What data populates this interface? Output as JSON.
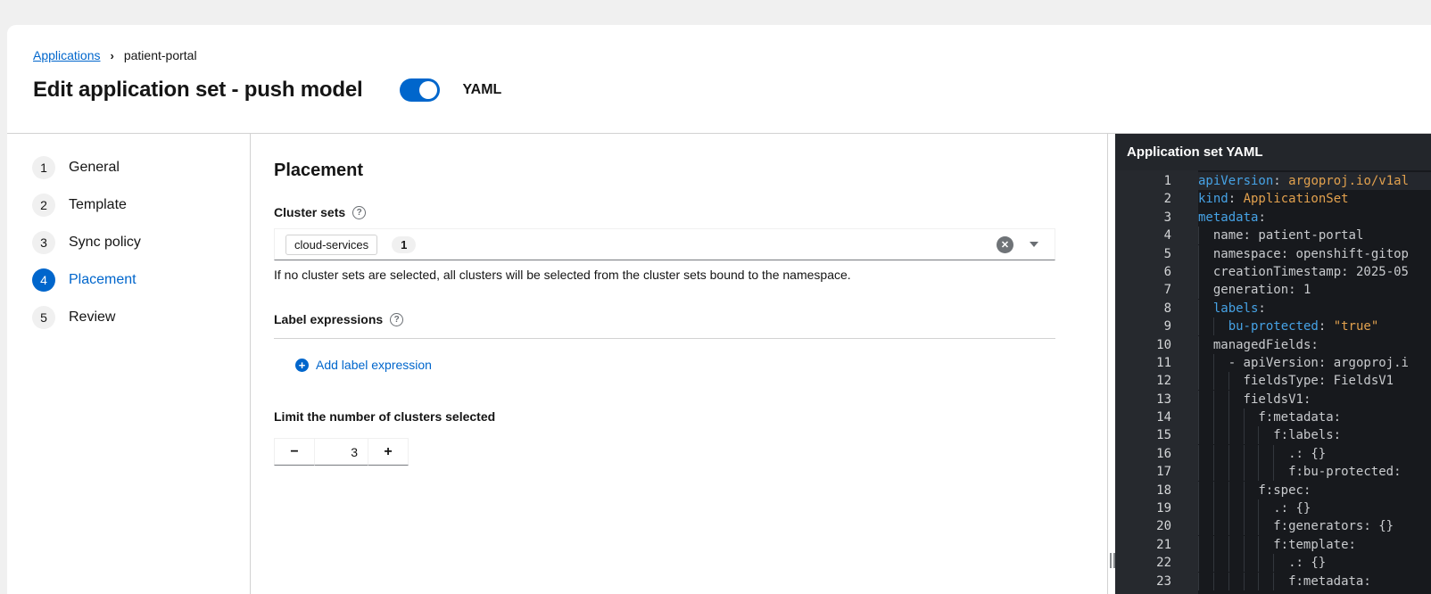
{
  "breadcrumb": {
    "link": "Applications",
    "current": "patient-portal"
  },
  "header": {
    "title": "Edit application set - push model",
    "toggle_label": "YAML",
    "toggle_on": true
  },
  "wizard": {
    "steps": [
      {
        "num": "1",
        "label": "General",
        "active": false
      },
      {
        "num": "2",
        "label": "Template",
        "active": false
      },
      {
        "num": "3",
        "label": "Sync policy",
        "active": false
      },
      {
        "num": "4",
        "label": "Placement",
        "active": true
      },
      {
        "num": "5",
        "label": "Review",
        "active": false
      }
    ]
  },
  "content": {
    "heading": "Placement",
    "cluster_sets": {
      "label": "Cluster sets",
      "chip": "cloud-services",
      "badge": "1",
      "helper": "If no cluster sets are selected, all clusters will be selected from the cluster sets bound to the namespace."
    },
    "label_expressions": {
      "label": "Label expressions",
      "add_link": "Add label expression"
    },
    "limit": {
      "label": "Limit the number of clusters selected",
      "value": "3"
    }
  },
  "icons": {
    "breadcrumb_separator": "›",
    "help": "?",
    "clear": "✕",
    "plus": "+",
    "minus": "−",
    "stepper_plus": "+"
  },
  "colors": {
    "accent_blue": "#0066cc",
    "page_bg": "#f0f0f0",
    "border": "#d2d2d2",
    "editor_bg": "#17191d",
    "editor_gutter_bg": "#26292e",
    "panel_header_bg": "#23262b",
    "yaml_key": "#46a2e5",
    "yaml_value": "#e2a14e",
    "yaml_plain": "#c9cbce"
  },
  "yaml_panel": {
    "title": "Application set YAML",
    "lines": [
      {
        "num": "1",
        "indent": 0,
        "hl": true,
        "parts": [
          [
            "k",
            "apiVersion"
          ],
          [
            "p",
            ": "
          ],
          [
            "v",
            "argoproj.io/v1al"
          ]
        ]
      },
      {
        "num": "2",
        "indent": 0,
        "hl": false,
        "parts": [
          [
            "k",
            "kind"
          ],
          [
            "p",
            ": "
          ],
          [
            "v",
            "ApplicationSet"
          ]
        ]
      },
      {
        "num": "3",
        "indent": 0,
        "hl": false,
        "parts": [
          [
            "k",
            "metadata"
          ],
          [
            "p",
            ":"
          ]
        ]
      },
      {
        "num": "4",
        "indent": 2,
        "hl": false,
        "parts": [
          [
            "p",
            "name: patient-portal"
          ]
        ]
      },
      {
        "num": "5",
        "indent": 2,
        "hl": false,
        "parts": [
          [
            "p",
            "namespace: openshift-gitop"
          ]
        ]
      },
      {
        "num": "6",
        "indent": 2,
        "hl": false,
        "parts": [
          [
            "p",
            "creationTimestamp: 2025-05"
          ]
        ]
      },
      {
        "num": "7",
        "indent": 2,
        "hl": false,
        "parts": [
          [
            "p",
            "generation: 1"
          ]
        ]
      },
      {
        "num": "8",
        "indent": 2,
        "hl": false,
        "parts": [
          [
            "k",
            "labels"
          ],
          [
            "p",
            ":"
          ]
        ]
      },
      {
        "num": "9",
        "indent": 4,
        "hl": false,
        "parts": [
          [
            "k",
            "bu-protected"
          ],
          [
            "p",
            ": "
          ],
          [
            "v",
            "\"true\""
          ]
        ]
      },
      {
        "num": "10",
        "indent": 2,
        "hl": false,
        "parts": [
          [
            "p",
            "managedFields:"
          ]
        ]
      },
      {
        "num": "11",
        "indent": 4,
        "hl": false,
        "parts": [
          [
            "p",
            "- apiVersion: argoproj.i"
          ]
        ]
      },
      {
        "num": "12",
        "indent": 6,
        "hl": false,
        "parts": [
          [
            "p",
            "fieldsType: FieldsV1"
          ]
        ]
      },
      {
        "num": "13",
        "indent": 6,
        "hl": false,
        "parts": [
          [
            "p",
            "fieldsV1:"
          ]
        ]
      },
      {
        "num": "14",
        "indent": 8,
        "hl": false,
        "parts": [
          [
            "p",
            "f:metadata:"
          ]
        ]
      },
      {
        "num": "15",
        "indent": 10,
        "hl": false,
        "parts": [
          [
            "p",
            "f:labels:"
          ]
        ]
      },
      {
        "num": "16",
        "indent": 12,
        "hl": false,
        "parts": [
          [
            "p",
            ".: {}"
          ]
        ]
      },
      {
        "num": "17",
        "indent": 12,
        "hl": false,
        "parts": [
          [
            "p",
            "f:bu-protected:"
          ]
        ]
      },
      {
        "num": "18",
        "indent": 8,
        "hl": false,
        "parts": [
          [
            "p",
            "f:spec:"
          ]
        ]
      },
      {
        "num": "19",
        "indent": 10,
        "hl": false,
        "parts": [
          [
            "p",
            ".: {}"
          ]
        ]
      },
      {
        "num": "20",
        "indent": 10,
        "hl": false,
        "parts": [
          [
            "p",
            "f:generators: {}"
          ]
        ]
      },
      {
        "num": "21",
        "indent": 10,
        "hl": false,
        "parts": [
          [
            "p",
            "f:template:"
          ]
        ]
      },
      {
        "num": "22",
        "indent": 12,
        "hl": false,
        "parts": [
          [
            "p",
            ".: {}"
          ]
        ]
      },
      {
        "num": "23",
        "indent": 12,
        "hl": false,
        "parts": [
          [
            "p",
            "f:metadata:"
          ]
        ]
      }
    ]
  }
}
